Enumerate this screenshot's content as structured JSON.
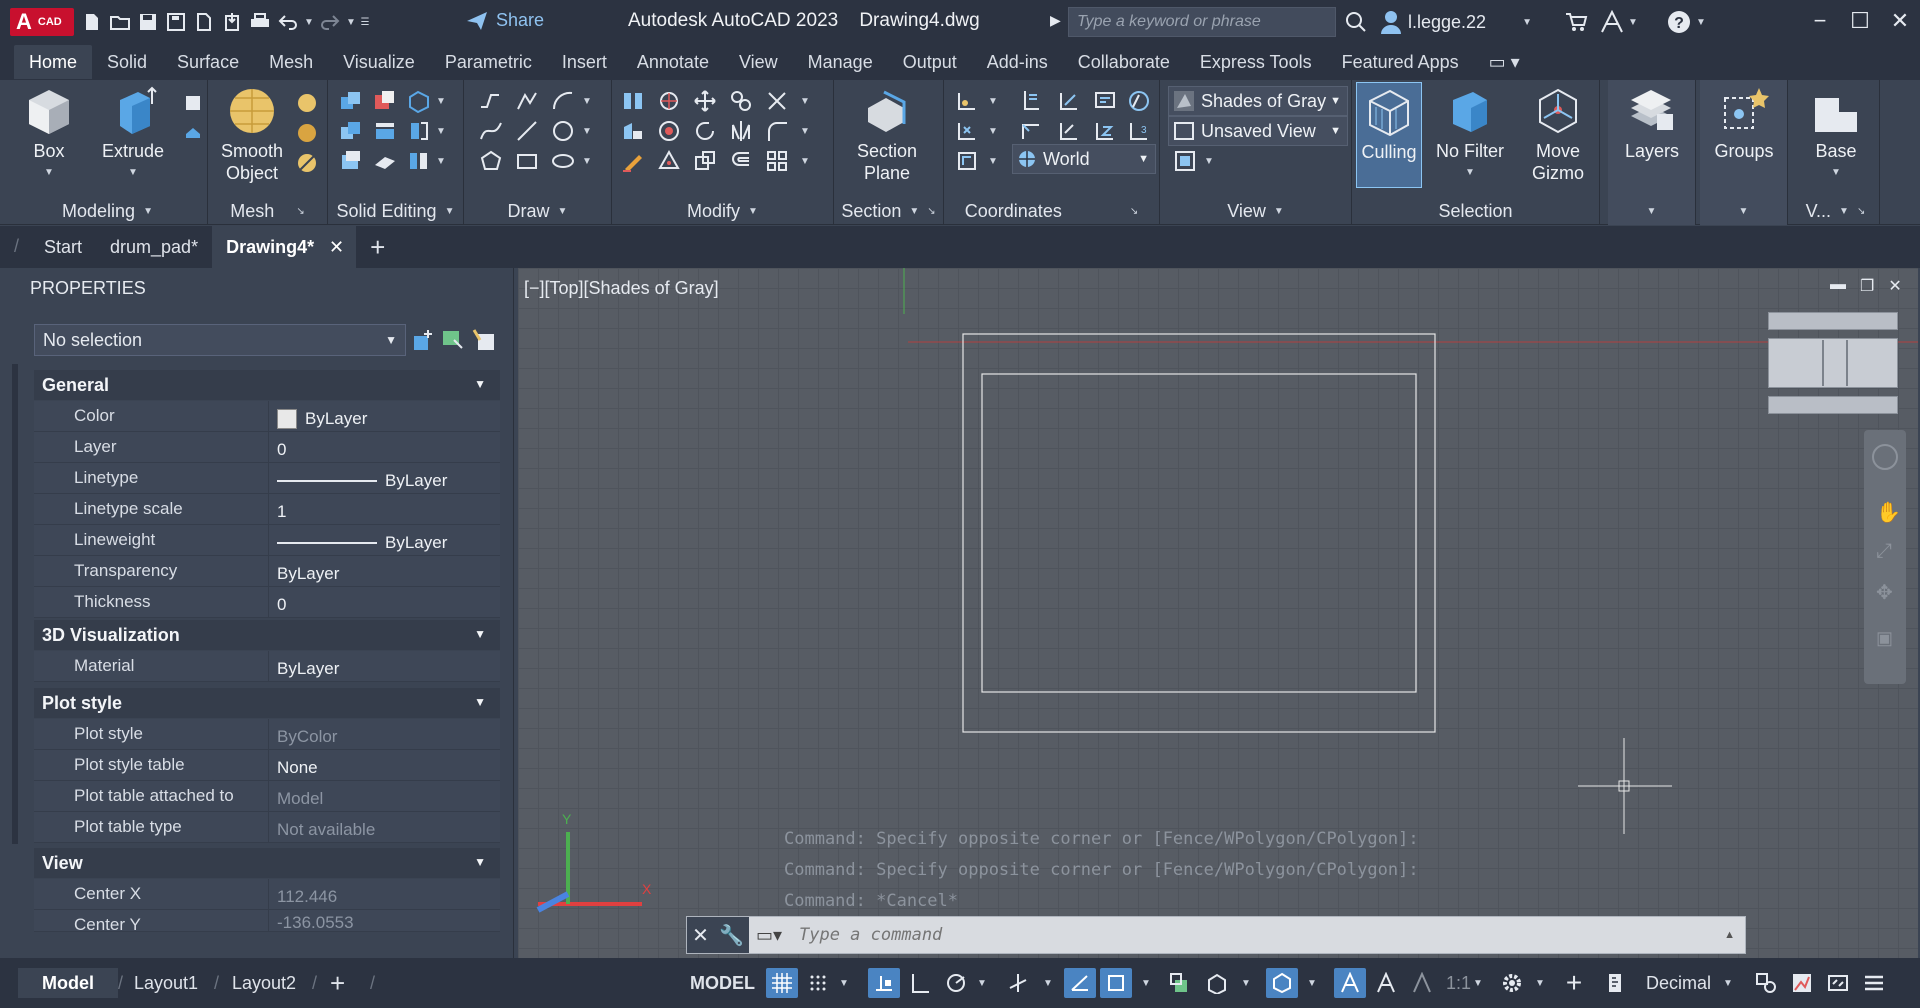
{
  "titlebar": {
    "logo_letter": "A",
    "logo_sub": "CAD",
    "share_label": "Share",
    "app_name": "Autodesk AutoCAD 2023",
    "file_name": "Drawing4.dwg",
    "search_placeholder": "Type a keyword or phrase",
    "user_name": "l.legge.22"
  },
  "menu_tabs": [
    "Home",
    "Solid",
    "Surface",
    "Mesh",
    "Visualize",
    "Parametric",
    "Insert",
    "Annotate",
    "View",
    "Manage",
    "Output",
    "Add-ins",
    "Collaborate",
    "Express Tools",
    "Featured Apps"
  ],
  "ribbon": {
    "modeling": {
      "title": "Modeling",
      "box": "Box",
      "extrude": "Extrude"
    },
    "mesh": {
      "title": "Mesh",
      "smooth_object_line1": "Smooth",
      "smooth_object_line2": "Object"
    },
    "solid_editing": {
      "title": "Solid Editing"
    },
    "draw": {
      "title": "Draw"
    },
    "modify": {
      "title": "Modify"
    },
    "section": {
      "title": "Section",
      "section_plane_line1": "Section",
      "section_plane_line2": "Plane"
    },
    "coordinates": {
      "title": "Coordinates",
      "ucs_value": "World"
    },
    "view": {
      "title": "View",
      "visual_style": "Shades of Gray",
      "named_view": "Unsaved View"
    },
    "selection": {
      "title": "Selection",
      "culling": "Culling",
      "no_filter": "No Filter",
      "move_gizmo_line1": "Move",
      "move_gizmo_line2": "Gizmo"
    },
    "layers": {
      "title": "Layers"
    },
    "groups": {
      "title": "Groups"
    },
    "base": {
      "title": "V...",
      "label": "Base"
    }
  },
  "doc_tabs": {
    "start": "Start",
    "tab1": "drum_pad*",
    "tab2": "Drawing4*"
  },
  "properties": {
    "header": "PROPERTIES",
    "selection": "No selection",
    "sections": {
      "general": "General",
      "viz3d": "3D Visualization",
      "plotstyle": "Plot style",
      "view": "View"
    },
    "general": [
      {
        "label": "Color",
        "value": "ByLayer"
      },
      {
        "label": "Layer",
        "value": "0"
      },
      {
        "label": "Linetype",
        "value": "ByLayer"
      },
      {
        "label": "Linetype scale",
        "value": "1"
      },
      {
        "label": "Lineweight",
        "value": "ByLayer"
      },
      {
        "label": "Transparency",
        "value": "ByLayer"
      },
      {
        "label": "Thickness",
        "value": "0"
      }
    ],
    "viz3d": [
      {
        "label": "Material",
        "value": "ByLayer"
      }
    ],
    "plotstyle": [
      {
        "label": "Plot style",
        "value": "ByColor"
      },
      {
        "label": "Plot style table",
        "value": "None"
      },
      {
        "label": "Plot table attached to",
        "value": "Model"
      },
      {
        "label": "Plot table type",
        "value": "Not available"
      }
    ],
    "view": [
      {
        "label": "Center X",
        "value": "112.446"
      },
      {
        "label": "Center Y",
        "value": "-136.0553"
      }
    ]
  },
  "viewport": {
    "label": "[−][Top][Shades of Gray]",
    "axis_x": "X",
    "axis_y": "Y",
    "command_history": [
      "Command: Specify opposite corner or [Fence/WPolygon/CPolygon]:",
      "Command: Specify opposite corner or [Fence/WPolygon/CPolygon]:",
      "Command: *Cancel*"
    ],
    "command_placeholder": "Type a command"
  },
  "statusbar": {
    "layout_tabs": [
      "Model",
      "Layout1",
      "Layout2"
    ],
    "model_label": "MODEL",
    "scale": "1:1",
    "units": "Decimal"
  },
  "colors": {
    "accent": "#4a84c2",
    "titlebar": "#2c3341",
    "ribbon": "#3b4453",
    "logo": "#c8102e"
  }
}
